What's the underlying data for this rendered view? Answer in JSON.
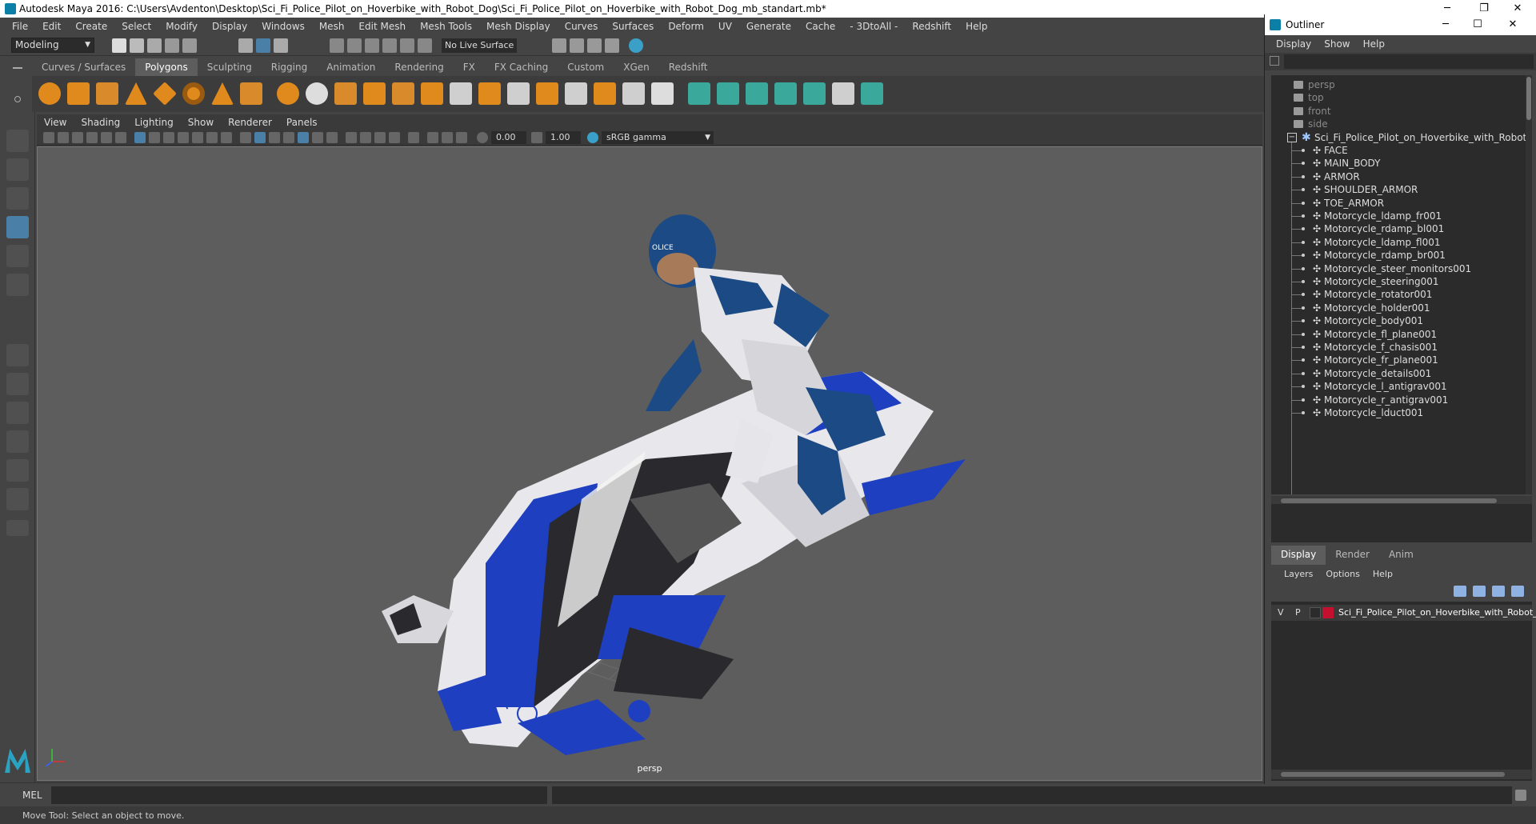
{
  "window": {
    "title": "Autodesk Maya 2016: C:\\Users\\Avdenton\\Desktop\\Sci_Fi_Police_Pilot_on_Hoverbike_with_Robot_Dog\\Sci_Fi_Police_Pilot_on_Hoverbike_with_Robot_Dog_mb_standart.mb*"
  },
  "menubar": [
    "File",
    "Edit",
    "Create",
    "Select",
    "Modify",
    "Display",
    "Windows",
    "Mesh",
    "Edit Mesh",
    "Mesh Tools",
    "Mesh Display",
    "Curves",
    "Surfaces",
    "Deform",
    "UV",
    "Generate",
    "Cache",
    "- 3DtoAll -",
    "Redshift",
    "Help"
  ],
  "statusline": {
    "mode": "Modeling",
    "live_surface": "No Live Surface"
  },
  "shelf_tabs": [
    {
      "label": "Curves / Surfaces",
      "active": false
    },
    {
      "label": "Polygons",
      "active": true
    },
    {
      "label": "Sculpting",
      "active": false
    },
    {
      "label": "Rigging",
      "active": false
    },
    {
      "label": "Animation",
      "active": false
    },
    {
      "label": "Rendering",
      "active": false
    },
    {
      "label": "FX",
      "active": false
    },
    {
      "label": "FX Caching",
      "active": false
    },
    {
      "label": "Custom",
      "active": false
    },
    {
      "label": "XGen",
      "active": false
    },
    {
      "label": "Redshift",
      "active": false
    }
  ],
  "viewport": {
    "menu": [
      "View",
      "Shading",
      "Lighting",
      "Show",
      "Renderer",
      "Panels"
    ],
    "exposure": "0.00",
    "gamma": "1.00",
    "color_space": "sRGB gamma",
    "camera_label": "persp"
  },
  "outliner": {
    "title": "Outliner",
    "menu": [
      "Display",
      "Show",
      "Help"
    ],
    "cameras": [
      "persp",
      "top",
      "front",
      "side"
    ],
    "root": "Sci_Fi_Police_Pilot_on_Hoverbike_with_Robot_Dog",
    "children": [
      "FACE",
      "MAIN_BODY",
      "ARMOR",
      "SHOULDER_ARMOR",
      "TOE_ARMOR",
      "Motorcycle_ldamp_fr001",
      "Motorcycle_rdamp_bl001",
      "Motorcycle_ldamp_fl001",
      "Motorcycle_rdamp_br001",
      "Motorcycle_steer_monitors001",
      "Motorcycle_steering001",
      "Motorcycle_rotator001",
      "Motorcycle_holder001",
      "Motorcycle_body001",
      "Motorcycle_fl_plane001",
      "Motorcycle_f_chasis001",
      "Motorcycle_fr_plane001",
      "Motorcycle_details001",
      "Motorcycle_l_antigrav001",
      "Motorcycle_r_antigrav001",
      "Motorcycle_lduct001"
    ]
  },
  "layer_editor": {
    "tabs": [
      {
        "label": "Display",
        "active": true
      },
      {
        "label": "Render",
        "active": false
      },
      {
        "label": "Anim",
        "active": false
      }
    ],
    "menu": [
      "Layers",
      "Options",
      "Help"
    ],
    "layer": {
      "v": "V",
      "p": "P",
      "name": "Sci_Fi_Police_Pilot_on_Hoverbike_with_Robot_Dog",
      "color": "#c4102f"
    }
  },
  "command_line": {
    "label": "MEL"
  },
  "help_line": "Move Tool: Select an object to move.",
  "colors": {
    "accent": "#4a80a8",
    "shelf_orange": "#e08a1e",
    "shelf_green": "#3aa89a"
  }
}
